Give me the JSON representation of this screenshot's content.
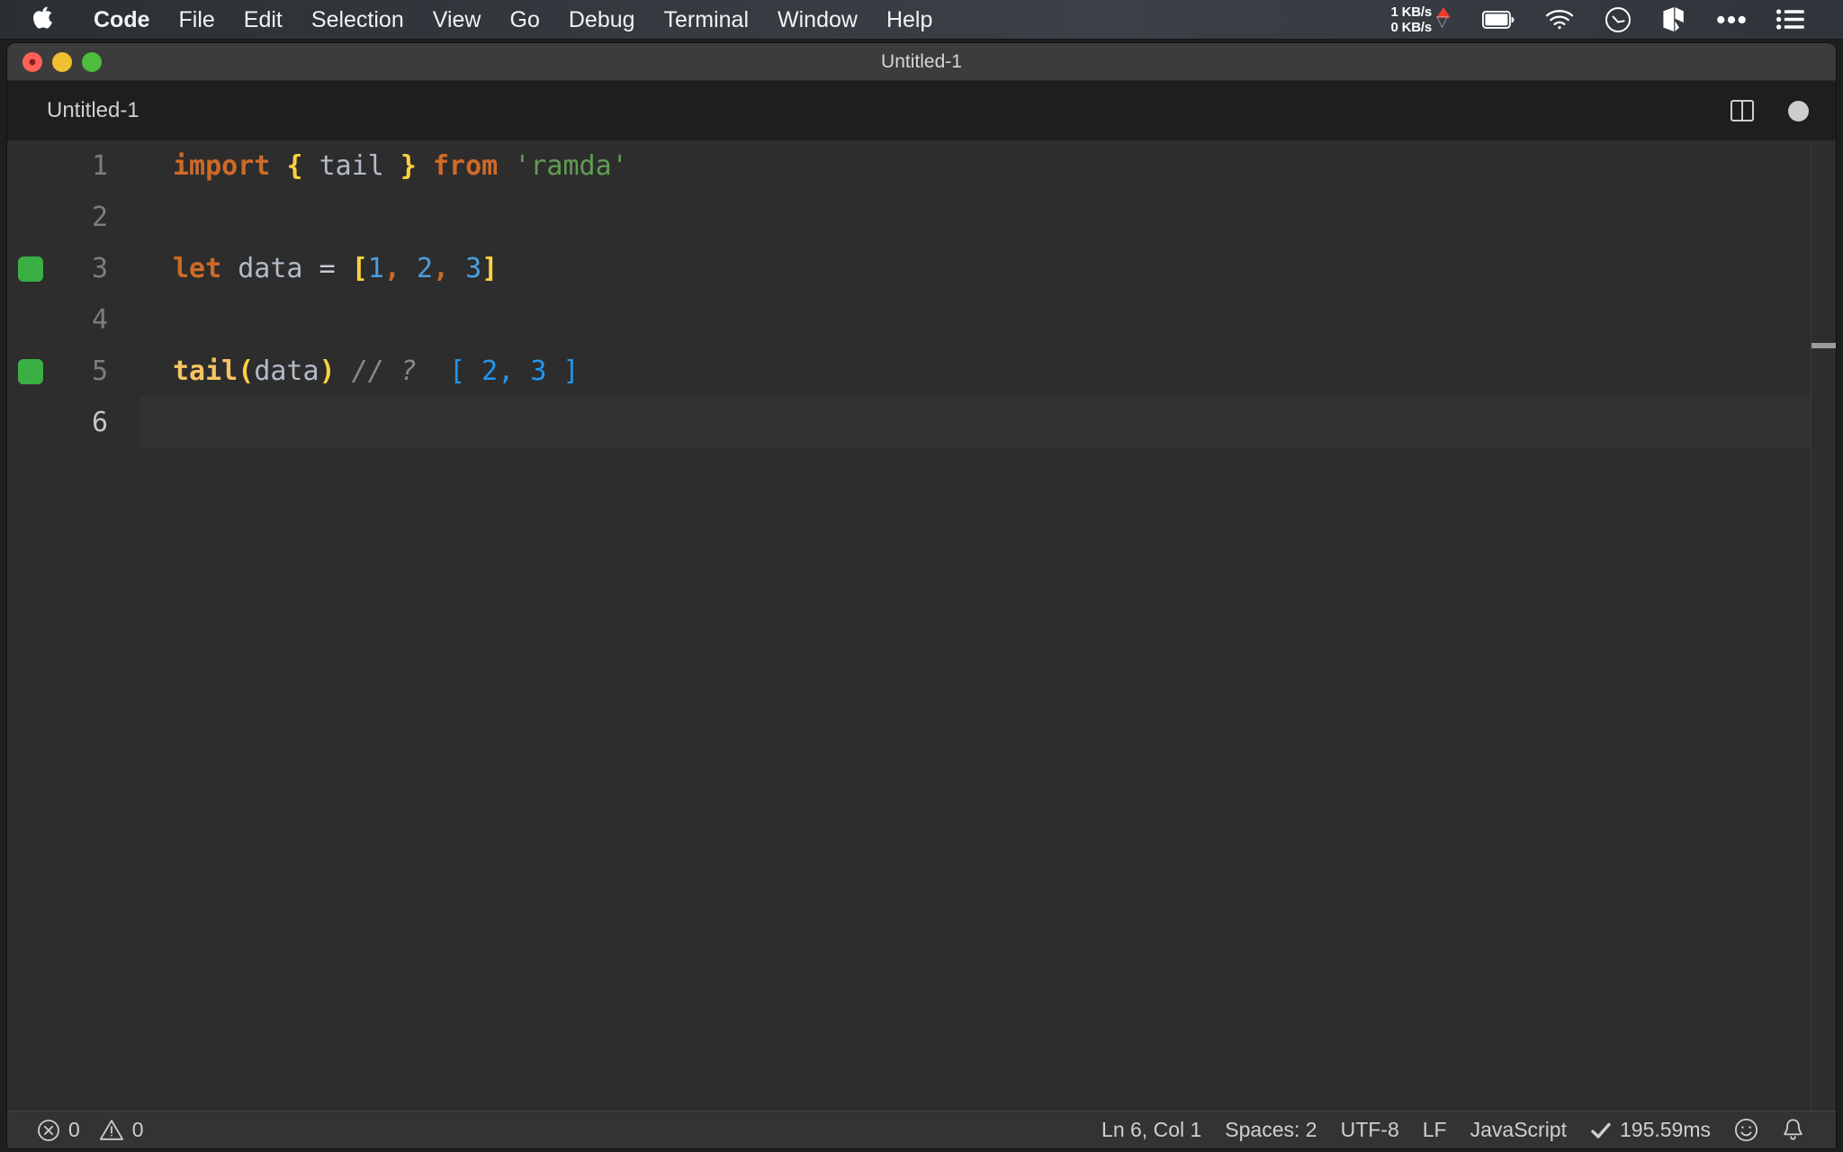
{
  "menubar": {
    "apple_icon": "apple-logo-icon",
    "items": [
      {
        "label": "Code",
        "bold": true
      },
      {
        "label": "File",
        "bold": false
      },
      {
        "label": "Edit",
        "bold": false
      },
      {
        "label": "Selection",
        "bold": false
      },
      {
        "label": "View",
        "bold": false
      },
      {
        "label": "Go",
        "bold": false
      },
      {
        "label": "Debug",
        "bold": false
      },
      {
        "label": "Terminal",
        "bold": false
      },
      {
        "label": "Window",
        "bold": false
      },
      {
        "label": "Help",
        "bold": false
      }
    ],
    "network": {
      "upload": "1 KB/s",
      "download": "0 KB/s",
      "upload_arrow_color": "#f03a2c",
      "download_arrow_color": "#9aa0a6"
    },
    "tray_icons": [
      "battery-icon",
      "wifi-icon",
      "gauge-circle-icon",
      "cube-icon",
      "ellipsis-icon",
      "list-menu-icon"
    ]
  },
  "window": {
    "title": "Untitled-1",
    "traffic_lights": {
      "close": "close-button",
      "minimize": "minimize-button",
      "zoom": "zoom-button",
      "close_color": "#ff6159",
      "minimize_color": "#efc02f",
      "zoom_color": "#4ebe3c"
    }
  },
  "tabbar": {
    "active_tab": "Untitled-1",
    "split_icon": "split-editor-icon",
    "dirty_indicator": "unsaved-changes-dot"
  },
  "theme": {
    "editor_bg": "#2d2d2d",
    "tabbar_bg": "#252526",
    "statusbar_bg": "#333333",
    "keyword": "#cf6a28",
    "variable": "#b3bcc8",
    "operator": "#c8ccd4",
    "brace_yellow": "#ffd23f",
    "number_blue": "#4a9fe0",
    "string_green": "#5f9d53",
    "function_yellow": "#f7c463",
    "comment_gray": "#8a8a8a",
    "result_blue": "#2196ef",
    "gutter_run_green": "#3ab044",
    "linenum": "#7d7d7d",
    "linenum_active": "#c6c6c6"
  },
  "editor": {
    "language": "JavaScript",
    "lines": [
      {
        "number": "1",
        "marker": false,
        "active": false,
        "tokens": [
          {
            "text": "import",
            "color": "#cf6a28",
            "bold": true,
            "italic": false
          },
          {
            "text": " ",
            "color": "#c8ccd4",
            "bold": false,
            "italic": false
          },
          {
            "text": "{",
            "color": "#ffd23f",
            "bold": true,
            "italic": false
          },
          {
            "text": " ",
            "color": "#c8ccd4",
            "bold": false,
            "italic": false
          },
          {
            "text": "tail",
            "color": "#b3bcc8",
            "bold": false,
            "italic": false
          },
          {
            "text": " ",
            "color": "#c8ccd4",
            "bold": false,
            "italic": false
          },
          {
            "text": "}",
            "color": "#ffd23f",
            "bold": true,
            "italic": false
          },
          {
            "text": " ",
            "color": "#c8ccd4",
            "bold": false,
            "italic": false
          },
          {
            "text": "from",
            "color": "#cf6a28",
            "bold": true,
            "italic": false
          },
          {
            "text": " ",
            "color": "#c8ccd4",
            "bold": false,
            "italic": false
          },
          {
            "text": "'ramda'",
            "color": "#5f9d53",
            "bold": false,
            "italic": false
          }
        ]
      },
      {
        "number": "2",
        "marker": false,
        "active": false,
        "tokens": []
      },
      {
        "number": "3",
        "marker": true,
        "active": false,
        "tokens": [
          {
            "text": "let",
            "color": "#cf6a28",
            "bold": true,
            "italic": false
          },
          {
            "text": " ",
            "color": "#c8ccd4",
            "bold": false,
            "italic": false
          },
          {
            "text": "data",
            "color": "#b3bcc8",
            "bold": false,
            "italic": false
          },
          {
            "text": " ",
            "color": "#c8ccd4",
            "bold": false,
            "italic": false
          },
          {
            "text": "=",
            "color": "#c8ccd4",
            "bold": false,
            "italic": false
          },
          {
            "text": " ",
            "color": "#c8ccd4",
            "bold": false,
            "italic": false
          },
          {
            "text": "[",
            "color": "#ffd23f",
            "bold": true,
            "italic": false
          },
          {
            "text": "1",
            "color": "#4a9fe0",
            "bold": false,
            "italic": false
          },
          {
            "text": ",",
            "color": "#cf6a28",
            "bold": true,
            "italic": false
          },
          {
            "text": " ",
            "color": "#c8ccd4",
            "bold": false,
            "italic": false
          },
          {
            "text": "2",
            "color": "#4a9fe0",
            "bold": false,
            "italic": false
          },
          {
            "text": ",",
            "color": "#cf6a28",
            "bold": true,
            "italic": false
          },
          {
            "text": " ",
            "color": "#c8ccd4",
            "bold": false,
            "italic": false
          },
          {
            "text": "3",
            "color": "#4a9fe0",
            "bold": false,
            "italic": false
          },
          {
            "text": "]",
            "color": "#ffd23f",
            "bold": true,
            "italic": false
          }
        ]
      },
      {
        "number": "4",
        "marker": false,
        "active": false,
        "tokens": []
      },
      {
        "number": "5",
        "marker": true,
        "active": false,
        "tokens": [
          {
            "text": "tail",
            "color": "#f7c463",
            "bold": true,
            "italic": false
          },
          {
            "text": "(",
            "color": "#ffd23f",
            "bold": true,
            "italic": false
          },
          {
            "text": "data",
            "color": "#b3bcc8",
            "bold": false,
            "italic": false
          },
          {
            "text": ")",
            "color": "#ffd23f",
            "bold": true,
            "italic": false
          },
          {
            "text": " ",
            "color": "#c8ccd4",
            "bold": false,
            "italic": false
          },
          {
            "text": "// ?",
            "color": "#8a8a8a",
            "bold": false,
            "italic": true
          },
          {
            "text": "  ",
            "color": "#c8ccd4",
            "bold": false,
            "italic": false
          },
          {
            "text": "[ 2, 3 ]",
            "color": "#2196ef",
            "bold": false,
            "italic": false
          }
        ]
      },
      {
        "number": "6",
        "marker": false,
        "active": true,
        "tokens": []
      }
    ]
  },
  "statusbar": {
    "errors": {
      "icon": "error-circle-icon",
      "count": "0"
    },
    "warnings": {
      "icon": "warning-triangle-icon",
      "count": "0"
    },
    "cursor_position": "Ln 6, Col 1",
    "indentation": "Spaces: 2",
    "encoding": "UTF-8",
    "eol": "LF",
    "language_mode": "JavaScript",
    "run_time": "195.59ms",
    "run_time_icon": "checkmark-icon",
    "feedback_icon": "smiley-icon",
    "notifications_icon": "bell-icon"
  }
}
